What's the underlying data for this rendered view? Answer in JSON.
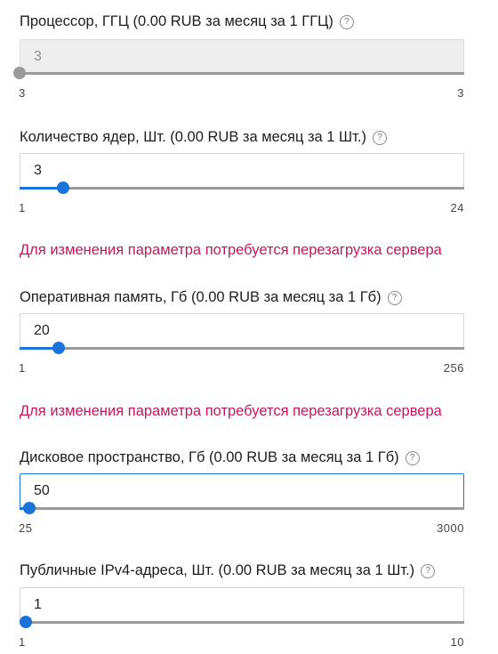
{
  "fields": [
    {
      "label": "Процессор, ГГЦ (0.00 RUB за месяц за 1 ГГЦ)",
      "value": "3",
      "min": "3",
      "max": "3",
      "fraction": 0.0
    },
    {
      "label": "Количество ядер, Шт. (0.00 RUB за месяц за 1 Шт.)",
      "value": "3",
      "min": "1",
      "max": "24",
      "fraction": 0.087
    },
    {
      "label": "Оперативная память, Гб (0.00 RUB за месяц за 1 Гб)",
      "value": "20",
      "min": "1",
      "max": "256",
      "fraction": 0.075
    },
    {
      "label": "Дисковое пространство, Гб (0.00 RUB за месяц за 1 Гб)",
      "value": "50",
      "min": "25",
      "max": "3000",
      "fraction": 0.008
    },
    {
      "label": "Публичные IPv4-адреса, Шт. (0.00 RUB за месяц за 1 Шт.)",
      "value": "1",
      "min": "1",
      "max": "10",
      "fraction": 0.0
    }
  ],
  "warning": "Для изменения параметра потребуется перезагрузка сервера",
  "help_glyph": "?",
  "colors": {
    "accent": "#1a73d9",
    "warning": "#c2185b",
    "disabled": "#9a9a9a"
  }
}
